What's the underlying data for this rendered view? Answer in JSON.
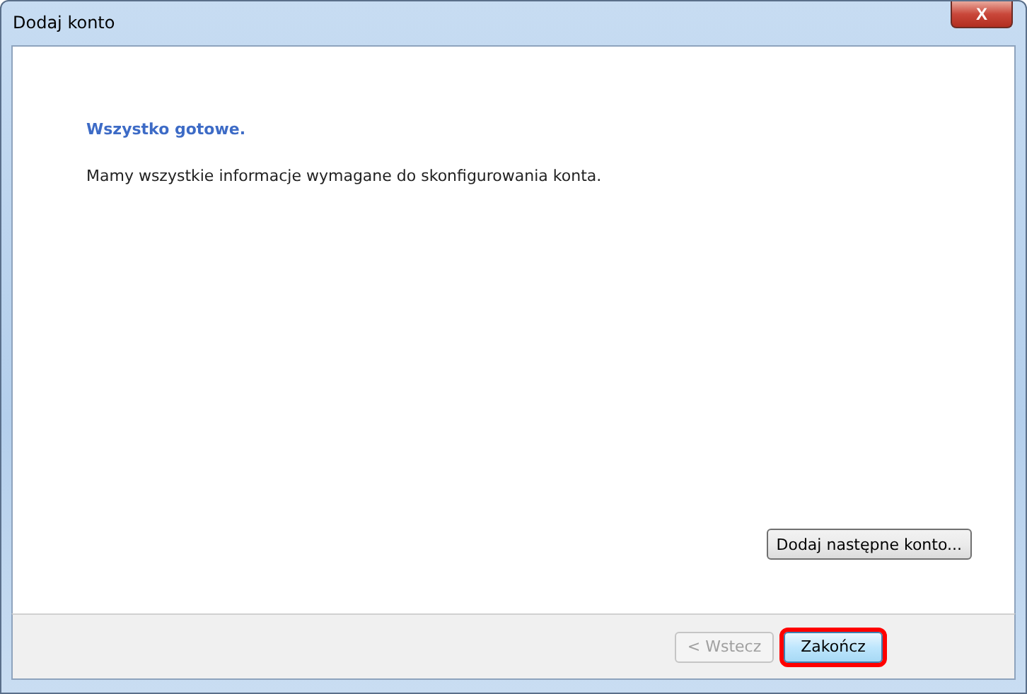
{
  "window": {
    "title": "Dodaj konto",
    "close_label": "X"
  },
  "content": {
    "heading": "Wszystko gotowe.",
    "message": "Mamy wszystkie informacje wymagane do skonfigurowania konta."
  },
  "add_account_button": {
    "label": "Dodaj następne konto...",
    "disabled": false
  },
  "buttons": [
    {
      "label": "< Wstecz",
      "disabled": true,
      "highlighted": false
    },
    {
      "label": "Zakończ",
      "disabled": false,
      "highlighted": true
    }
  ]
}
